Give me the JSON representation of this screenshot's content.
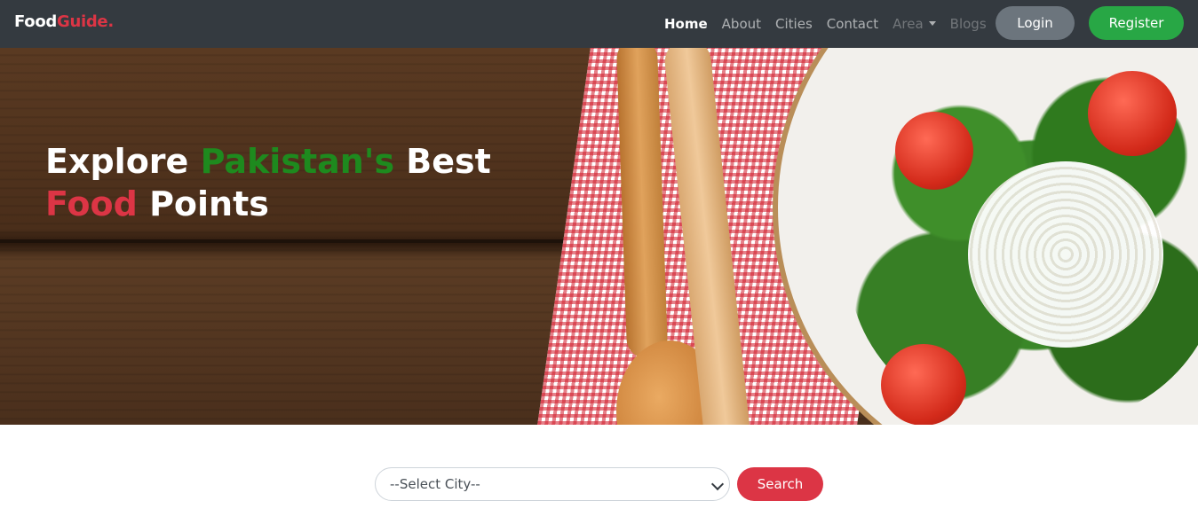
{
  "brand": {
    "part1": "Food",
    "part2": "Guide."
  },
  "nav": {
    "items": [
      {
        "label": "Home"
      },
      {
        "label": "About"
      },
      {
        "label": "Cities"
      },
      {
        "label": "Contact"
      },
      {
        "label": "Area"
      },
      {
        "label": "Blogs"
      }
    ],
    "login_label": "Login",
    "register_label": "Register"
  },
  "hero": {
    "word_explore": "Explore",
    "word_pakistans": "Pakistan's",
    "word_best": "Best",
    "word_food": "Food",
    "word_points": "Points"
  },
  "search": {
    "select_value": "--Select City--",
    "button_label": "Search"
  },
  "colors": {
    "navbar": "#343a40",
    "accent_red": "#dc3545",
    "accent_green": "#28a745",
    "login_gray": "#6c757d"
  }
}
